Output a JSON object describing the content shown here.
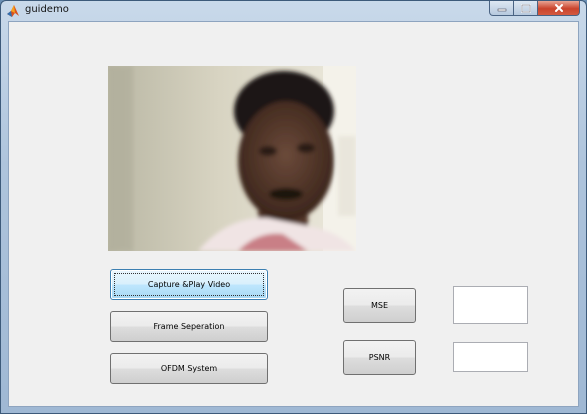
{
  "window": {
    "title": "guidemo"
  },
  "buttons": {
    "capture": "Capture &Play Video",
    "frame": "Frame Seperation",
    "ofdm": "OFDM System",
    "mse": "MSE",
    "psnr": "PSNR"
  },
  "fields": {
    "mse_value": "",
    "psnr_value": ""
  },
  "icons": {
    "app": "matlab-icon",
    "minimize": "minimize-icon",
    "maximize": "maximize-icon",
    "close": "close-icon"
  },
  "colors": {
    "active_button": "#bee6fd",
    "close_button": "#c9432c",
    "panel": "#f0f0f0"
  }
}
